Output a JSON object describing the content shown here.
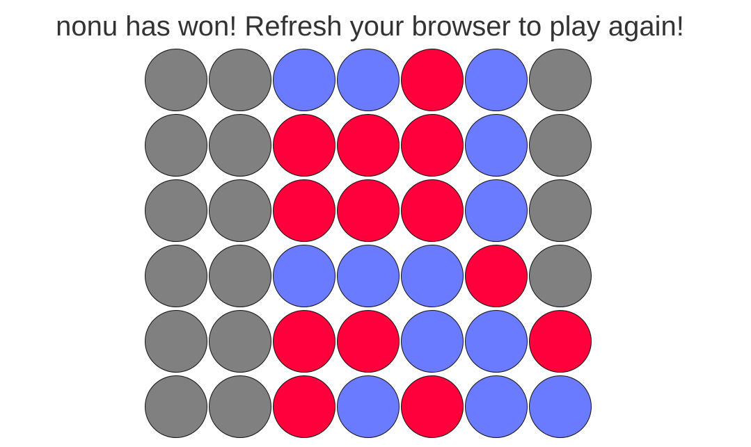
{
  "status": {
    "message": "nonu has won! Refresh your browser to play again!"
  },
  "colors": {
    "empty": "#808080",
    "red": "#ff003c",
    "blue": "#6b7bff"
  },
  "board": {
    "columns": 7,
    "rows": 6,
    "cells": [
      [
        "empty",
        "empty",
        "blue",
        "blue",
        "red",
        "blue",
        "empty"
      ],
      [
        "empty",
        "empty",
        "red",
        "red",
        "red",
        "blue",
        "empty"
      ],
      [
        "empty",
        "empty",
        "red",
        "red",
        "red",
        "blue",
        "empty"
      ],
      [
        "empty",
        "empty",
        "blue",
        "blue",
        "blue",
        "red",
        "empty"
      ],
      [
        "empty",
        "empty",
        "red",
        "red",
        "blue",
        "blue",
        "red"
      ],
      [
        "empty",
        "empty",
        "red",
        "blue",
        "red",
        "blue",
        "blue"
      ]
    ]
  }
}
